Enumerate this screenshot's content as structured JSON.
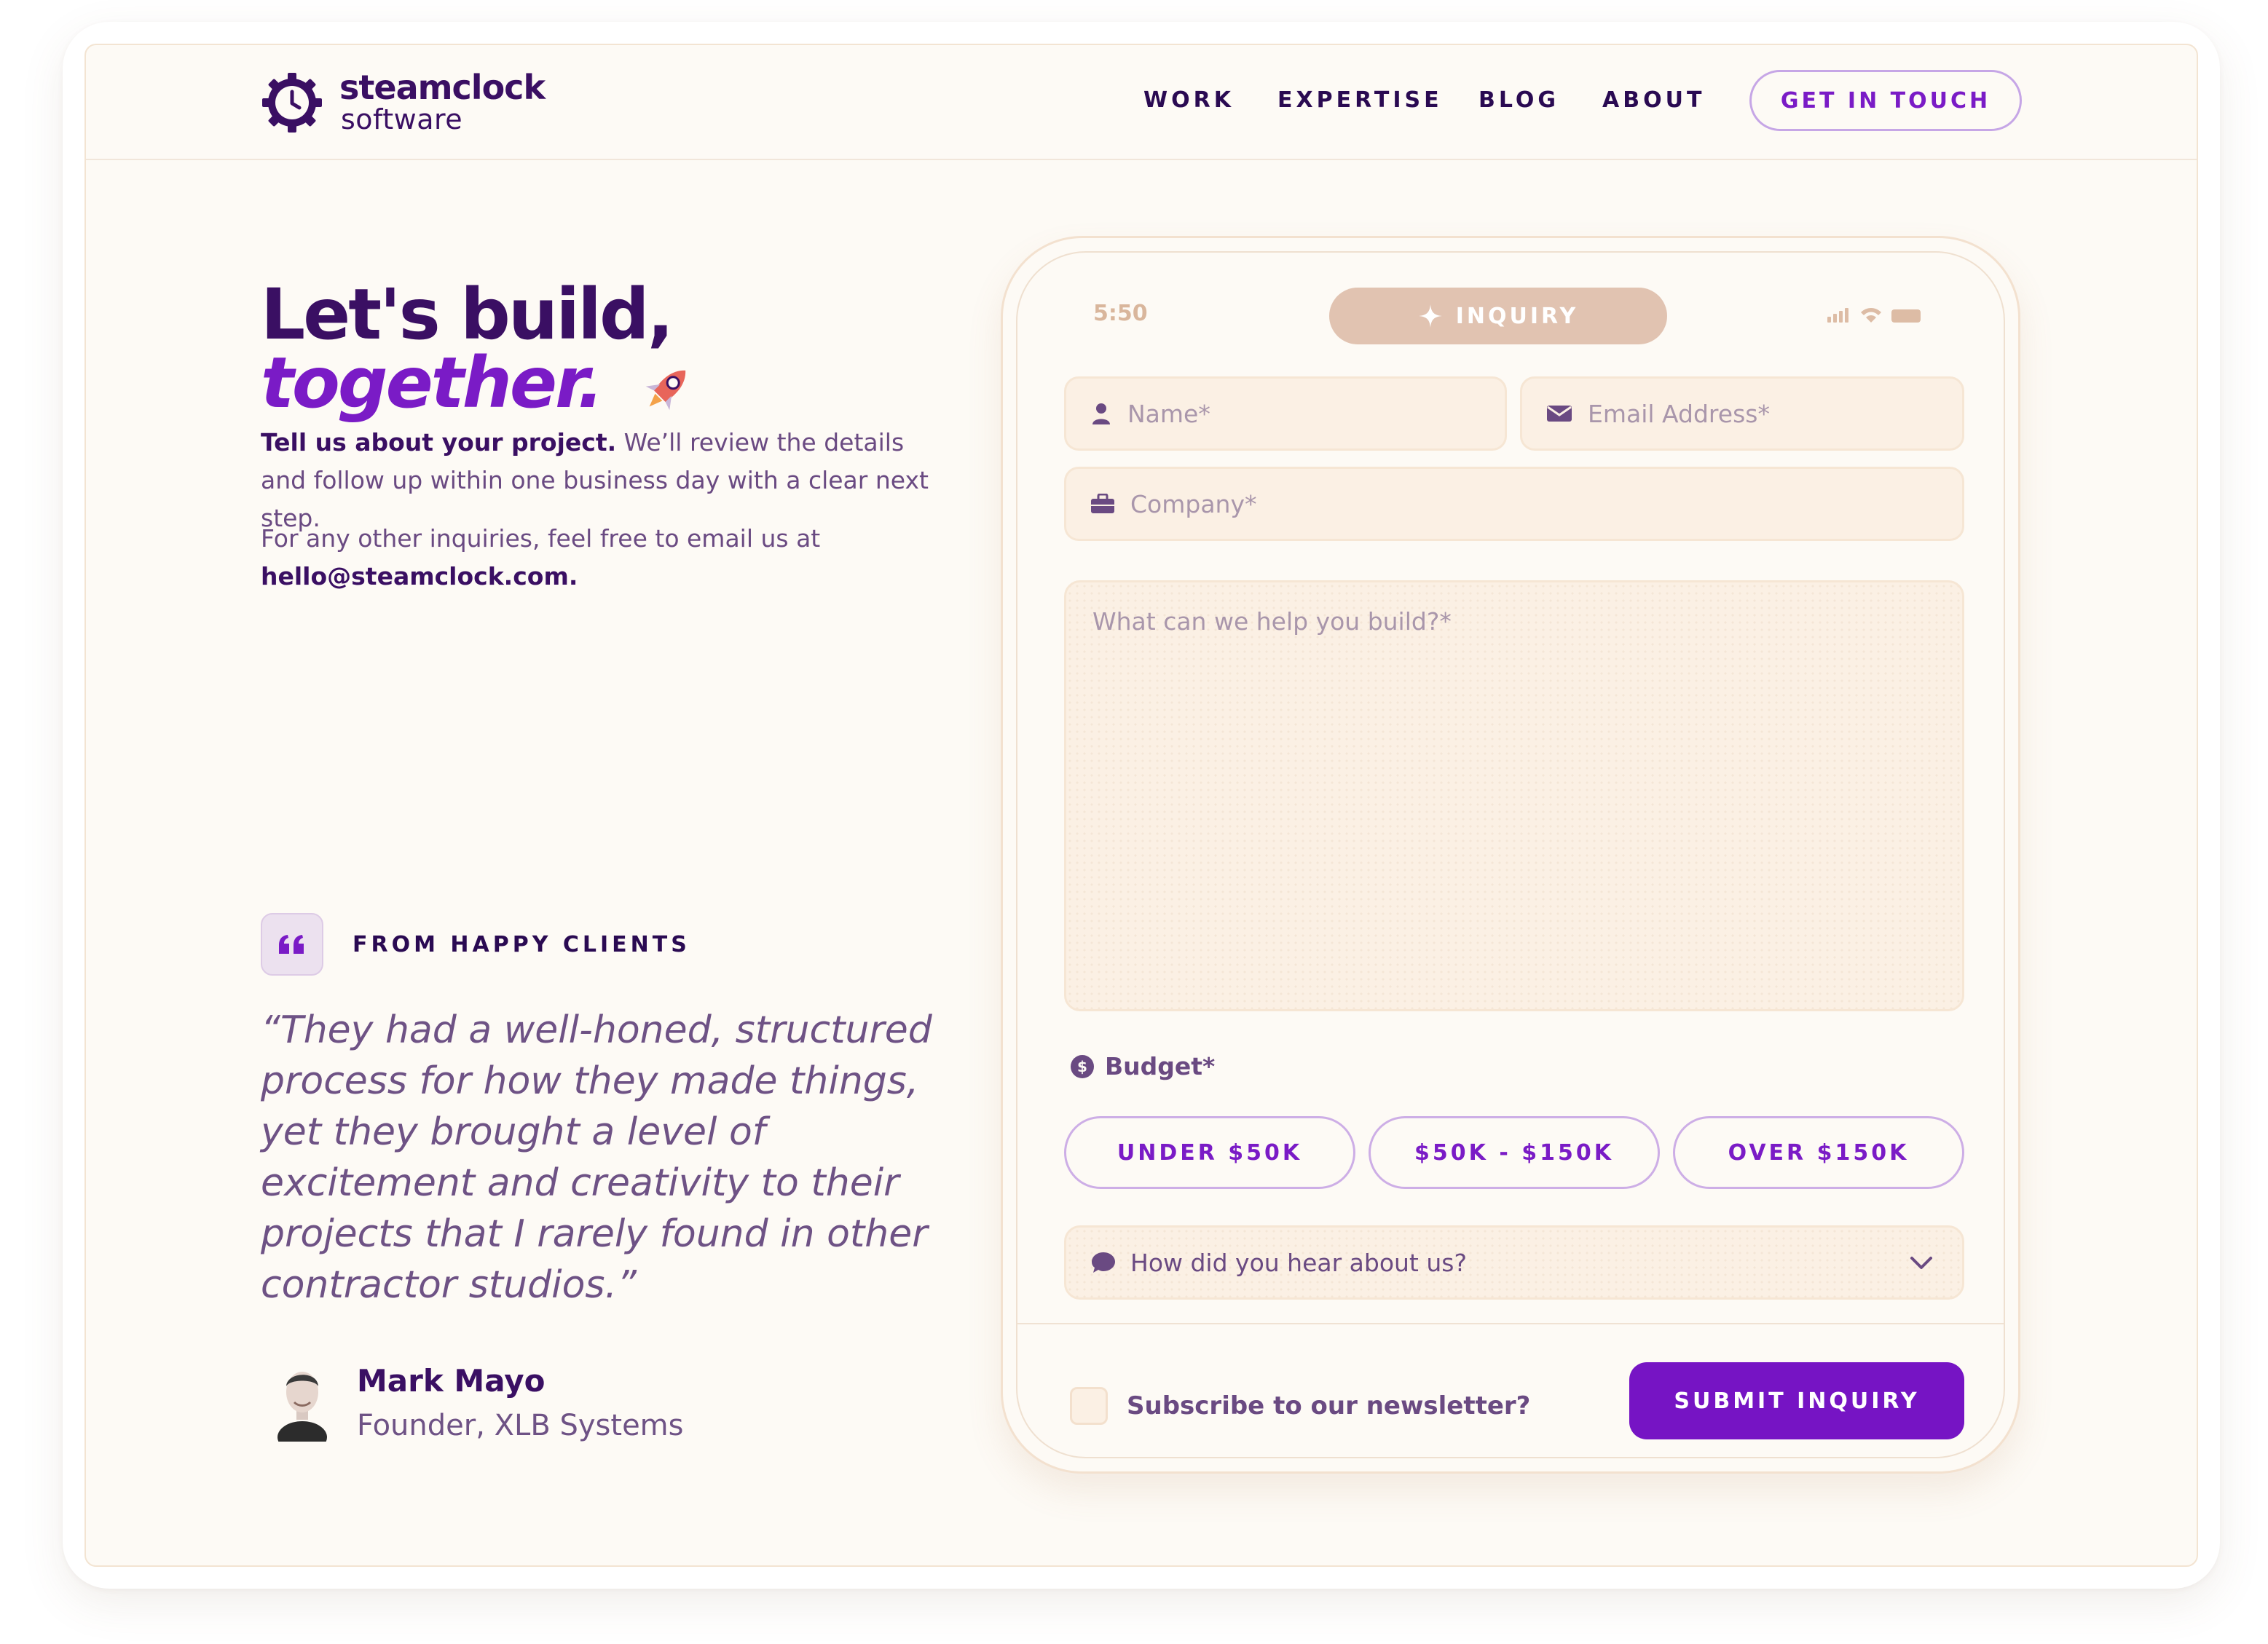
{
  "brand": {
    "name": "steamclock",
    "sub": "software",
    "primary_color": "#3a0f63",
    "accent_color": "#7a1bc6"
  },
  "nav": {
    "items": [
      "WORK",
      "EXPERTISE",
      "BLOG",
      "ABOUT"
    ],
    "cta": "GET IN TOUCH"
  },
  "hero": {
    "line1": "Let's build,",
    "line2": "together."
  },
  "intro": {
    "bold": "Tell us about your project.",
    "rest": " We’ll review the details and follow up within one business day with a clear next step.",
    "other": "For any other inquiries, feel free to email us at",
    "email": "hello@steamclock.com."
  },
  "testimonial": {
    "label": "FROM HAPPY CLIENTS",
    "quote": "“They had a well-honed, structured process for how they made things, yet they brought a level of excitement and creativity to their projects that I rarely found in other contractor studios.”",
    "name": "Mark Mayo",
    "role": "Founder, XLB Systems"
  },
  "phone": {
    "time": "5:50",
    "pill": "INQUIRY"
  },
  "form": {
    "name_placeholder": "Name*",
    "email_placeholder": "Email Address*",
    "company_placeholder": "Company*",
    "message_placeholder": "What can we help you build?*",
    "budget_label": "Budget*",
    "budget_options": [
      "UNDER $50K",
      "$50K - $150K",
      "OVER $150K"
    ],
    "source_select": "How did you hear about us?",
    "newsletter_label": "Subscribe to our newsletter?",
    "submit": "SUBMIT INQUIRY"
  }
}
